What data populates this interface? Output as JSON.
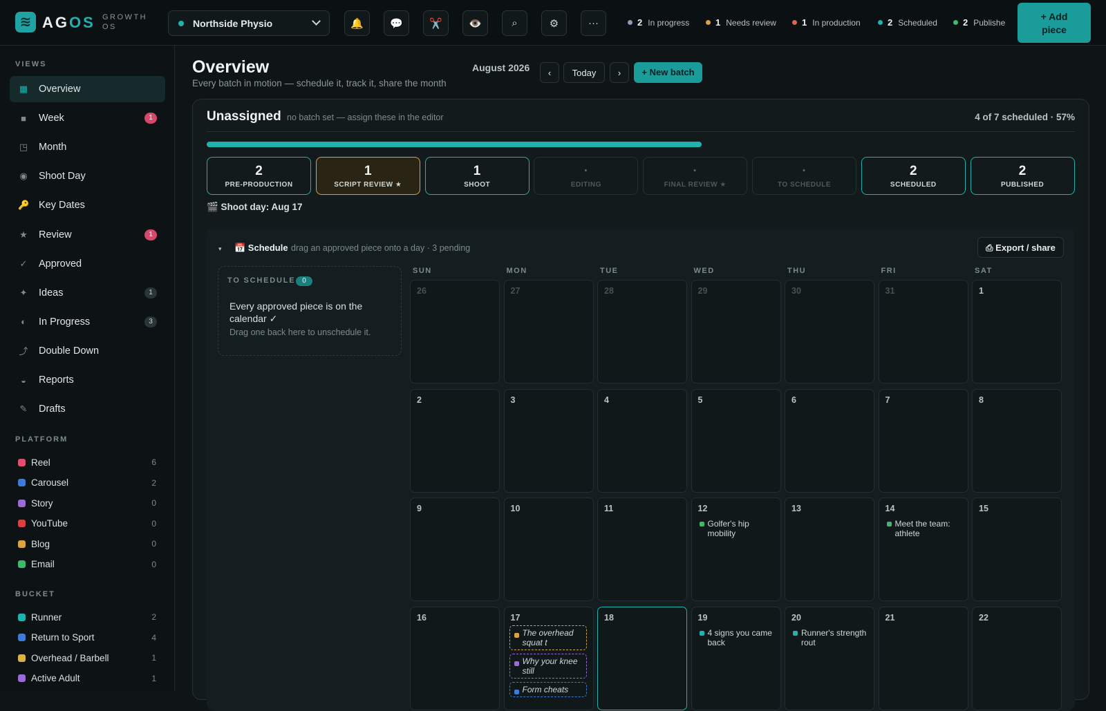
{
  "brand": {
    "name_a": "AG",
    "name_b": "OS",
    "sub_1": "GROWTH",
    "sub_2": "OS",
    "logo_icon": "wave-logo-icon"
  },
  "client": {
    "name": "Northside Physio"
  },
  "toolbar": {
    "icons": [
      "bell-icon",
      "chat-icon",
      "scissors-icon",
      "eye-icon",
      "search-icon",
      "gear-icon",
      "more-icon"
    ],
    "glyphs": [
      "🔔",
      "💬",
      "✂️",
      "👁️",
      "⌕",
      "⚙",
      "···"
    ]
  },
  "stats": [
    {
      "count": "2",
      "label": "In progress",
      "color": "#8e9bb8"
    },
    {
      "count": "1",
      "label": "Needs review",
      "color": "#d9a441"
    },
    {
      "count": "1",
      "label": "In production",
      "color": "#e0664f"
    },
    {
      "count": "2",
      "label": "Scheduled",
      "color": "#1fb3b0"
    },
    {
      "count": "2",
      "label": "Publishe",
      "color": "#3fb86e"
    }
  ],
  "add_piece": {
    "line1": "+ Add",
    "line2": "piece"
  },
  "sidebar": {
    "views_label": "VIEWS",
    "items": [
      {
        "label": "Overview",
        "icon": "▦",
        "badge": ""
      },
      {
        "label": "Week",
        "icon": "■",
        "badge": "1"
      },
      {
        "label": "Month",
        "icon": "◳",
        "badge": ""
      },
      {
        "label": "Shoot Day",
        "icon": "◉",
        "badge": ""
      },
      {
        "label": "Key Dates",
        "icon": "🔑",
        "badge": ""
      },
      {
        "label": "Review",
        "icon": "★",
        "badge": "1"
      },
      {
        "label": "Approved",
        "icon": "✓",
        "badge": ""
      },
      {
        "label": "Ideas",
        "icon": "✦",
        "badge": "1"
      },
      {
        "label": "In Progress",
        "icon": "◐",
        "badge": "3"
      },
      {
        "label": "Double Down",
        "icon": "⤴",
        "badge": ""
      },
      {
        "label": "Reports",
        "icon": "◒",
        "badge": ""
      },
      {
        "label": "Drafts",
        "icon": "✎",
        "badge": ""
      }
    ],
    "platform_label": "PLATFORM",
    "platforms": [
      {
        "label": "Reel",
        "count": "6",
        "color": "#e0506e"
      },
      {
        "label": "Carousel",
        "count": "2",
        "color": "#3d7bd9"
      },
      {
        "label": "Story",
        "count": "0",
        "color": "#9b6bd6"
      },
      {
        "label": "YouTube",
        "count": "0",
        "color": "#d94040"
      },
      {
        "label": "Blog",
        "count": "0",
        "color": "#d9a441"
      },
      {
        "label": "Email",
        "count": "0",
        "color": "#3fb86e"
      }
    ],
    "bucket_label": "BUCKET",
    "buckets": [
      {
        "label": "Runner",
        "count": "2",
        "color": "#1fb3b0"
      },
      {
        "label": "Return to Sport",
        "count": "4",
        "color": "#3d7bd9"
      },
      {
        "label": "Overhead / Barbell",
        "count": "1",
        "color": "#d9b441"
      },
      {
        "label": "Active Adult",
        "count": "1",
        "color": "#9b6bd6"
      }
    ]
  },
  "page": {
    "title": "Overview",
    "subtitle": "Every batch in motion — schedule it, track it, share the month",
    "month": "August 2026",
    "prev": "‹",
    "today": "Today",
    "next": "›",
    "new_batch": "+ New batch"
  },
  "batch": {
    "title": "Unassigned",
    "note": "no batch set — assign these in the editor",
    "progress_text": "4 of 7 scheduled · 57%",
    "progress": 0.57,
    "stages": [
      {
        "count": "2",
        "label": "PRE-PRODUCTION",
        "style": "teal"
      },
      {
        "count": "1",
        "label": "SCRIPT REVIEW ★",
        "style": "gold"
      },
      {
        "count": "1",
        "label": "SHOOT",
        "style": "teal"
      },
      {
        "count": "·",
        "label": "EDITING",
        "style": "dim"
      },
      {
        "count": "·",
        "label": "FINAL REVIEW ★",
        "style": "dim"
      },
      {
        "count": "·",
        "label": "TO SCHEDULE",
        "style": "dim"
      },
      {
        "count": "2",
        "label": "SCHEDULED",
        "style": "teal"
      },
      {
        "count": "2",
        "label": "PUBLISHED",
        "style": "teal"
      }
    ],
    "shoot_day": "🎬 Shoot day: Aug 17"
  },
  "schedule": {
    "caret": "▾",
    "title": "📅 Schedule",
    "note": "drag an approved piece onto a day · 3 pending",
    "export": "⎙ Export / share",
    "to_schedule_label": "TO SCHEDULE",
    "to_schedule_count": "0",
    "empty_msg": "Every approved piece is on the calendar ✓",
    "empty_sub": "Drag one back here to unschedule it.",
    "weekdays": [
      "SUN",
      "MON",
      "TUE",
      "WED",
      "THU",
      "FRI",
      "SAT"
    ],
    "weeks": [
      [
        {
          "d": "26",
          "off": true
        },
        {
          "d": "27",
          "off": true
        },
        {
          "d": "28",
          "off": true
        },
        {
          "d": "29",
          "off": true
        },
        {
          "d": "30",
          "off": true
        },
        {
          "d": "31",
          "off": true
        },
        {
          "d": "1"
        }
      ],
      [
        {
          "d": "2"
        },
        {
          "d": "3"
        },
        {
          "d": "4"
        },
        {
          "d": "5"
        },
        {
          "d": "6"
        },
        {
          "d": "7"
        },
        {
          "d": "8"
        }
      ],
      [
        {
          "d": "9"
        },
        {
          "d": "10"
        },
        {
          "d": "11"
        },
        {
          "d": "12",
          "events": [
            {
              "t": "Golfer's hip mobility",
              "c": "#3fb86e"
            }
          ]
        },
        {
          "d": "13"
        },
        {
          "d": "14",
          "events": [
            {
              "t": "Meet the team: athlete",
              "c": "#3fb86e"
            }
          ]
        },
        {
          "d": "15"
        }
      ],
      [
        {
          "d": "16"
        },
        {
          "d": "17",
          "pending": [
            {
              "t": "The overhead squat t",
              "c": "#d9a441"
            },
            {
              "t": "Why your knee still",
              "c": "#9b6bd6"
            },
            {
              "t": "Form cheats",
              "c": "#3d7bd9"
            }
          ]
        },
        {
          "d": "18",
          "today": true
        },
        {
          "d": "19",
          "events": [
            {
              "t": "4 signs you came back",
              "c": "#1fb3b0"
            }
          ]
        },
        {
          "d": "20",
          "events": [
            {
              "t": "Runner's strength rout",
              "c": "#1fb3b0"
            }
          ]
        },
        {
          "d": "21"
        },
        {
          "d": "22"
        }
      ]
    ]
  }
}
